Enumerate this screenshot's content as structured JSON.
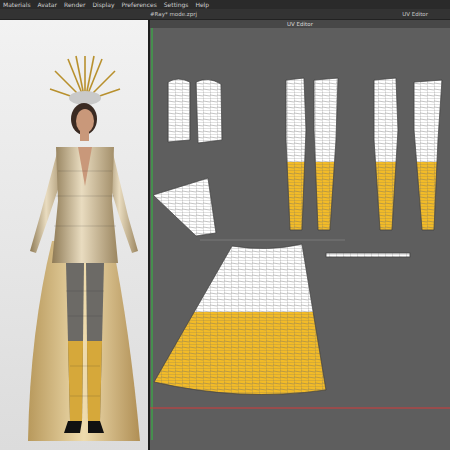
{
  "menu": [
    "Materials",
    "Avatar",
    "Render",
    "Display",
    "Preferences",
    "Settings",
    "Help"
  ],
  "file_tab": "#Ray* mode.zprj",
  "right_tab": "UV Editor",
  "panel_title": "UV Editor"
}
